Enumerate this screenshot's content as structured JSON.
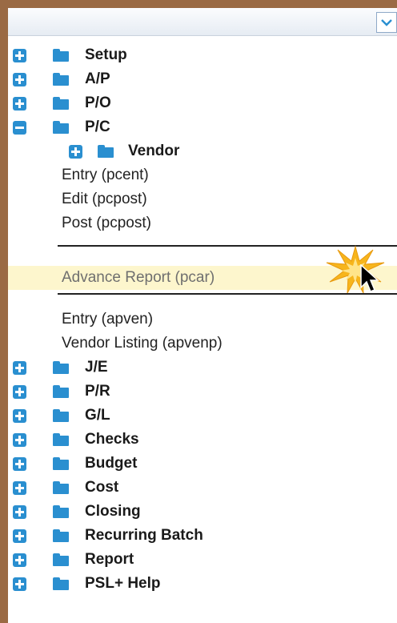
{
  "tree": {
    "top_nodes": [
      {
        "label": "Setup"
      },
      {
        "label": "A/P"
      },
      {
        "label": "P/O"
      },
      {
        "label": "P/C"
      }
    ],
    "pc_children": {
      "vendor_label": "Vendor",
      "leaf_items": [
        "Entry (pcent)",
        "Edit (pcpost)",
        "Post (pcpost)"
      ],
      "highlighted_item": "Advance Report (pcar)",
      "vendor_items": [
        "Entry (apven)",
        "Vendor Listing (apvenp)"
      ]
    },
    "bottom_nodes": [
      {
        "label": "J/E"
      },
      {
        "label": "P/R"
      },
      {
        "label": "G/L"
      },
      {
        "label": "Checks"
      },
      {
        "label": "Budget"
      },
      {
        "label": "Cost"
      },
      {
        "label": "Closing"
      },
      {
        "label": "Recurring Batch"
      },
      {
        "label": "Report"
      },
      {
        "label": "PSL+ Help"
      }
    ]
  },
  "icons": {
    "expand": "plus-square-icon",
    "collapse": "minus-square-icon",
    "folder": "folder-icon",
    "dropdown": "chevron-down-icon",
    "cursor": "mouse-pointer-icon",
    "click": "click-burst-icon"
  },
  "colors": {
    "accent": "#2a8fd0",
    "highlight": "#fdf6cd",
    "burst": "#f7b51c",
    "frame": "#9a6a44"
  }
}
